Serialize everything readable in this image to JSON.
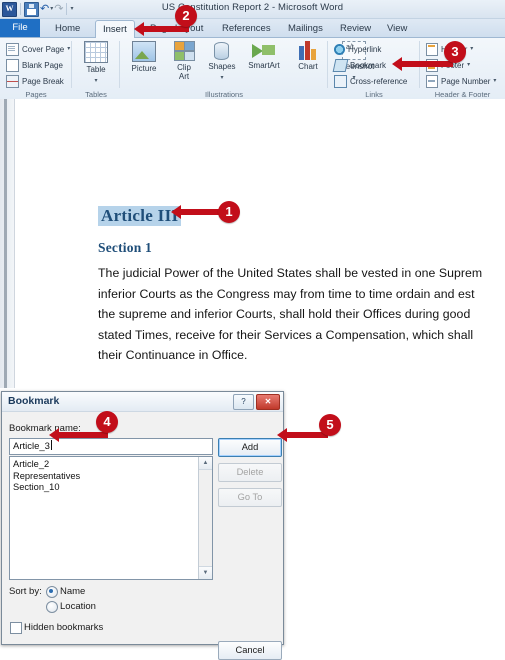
{
  "window": {
    "document_title": "US Constitution Report 2  -  Microsoft Word",
    "quick_access": [
      {
        "name": "word-logo",
        "glyph": "W"
      },
      {
        "name": "save-icon",
        "glyph": ""
      },
      {
        "name": "undo-icon",
        "glyph": "↶"
      },
      {
        "name": "redo-icon",
        "glyph": "↷"
      },
      {
        "name": "customize-qat-icon",
        "glyph": "▾"
      }
    ]
  },
  "tabs": [
    {
      "label": "File",
      "active": false
    },
    {
      "label": "Home",
      "active": false
    },
    {
      "label": "Insert",
      "active": true
    },
    {
      "label": "Page Layout",
      "active": false
    },
    {
      "label": "References",
      "active": false
    },
    {
      "label": "Mailings",
      "active": false
    },
    {
      "label": "Review",
      "active": false
    },
    {
      "label": "View",
      "active": false
    }
  ],
  "ribbon": {
    "groups": [
      {
        "name": "Pages",
        "items": [
          {
            "label": "Cover Page",
            "dropdown": true
          },
          {
            "label": "Blank Page",
            "dropdown": false
          },
          {
            "label": "Page Break",
            "dropdown": false
          }
        ]
      },
      {
        "name": "Tables",
        "items": [
          {
            "label": "Table",
            "dropdown": true
          }
        ]
      },
      {
        "name": "Illustrations",
        "items": [
          {
            "label": "Picture",
            "dropdown": false
          },
          {
            "label": "Clip\nArt",
            "dropdown": false
          },
          {
            "label": "Shapes",
            "dropdown": true
          },
          {
            "label": "SmartArt",
            "dropdown": false
          },
          {
            "label": "Chart",
            "dropdown": false
          },
          {
            "label": "Screenshot",
            "dropdown": true
          }
        ]
      },
      {
        "name": "Links",
        "items": [
          {
            "label": "Hyperlink",
            "dropdown": false
          },
          {
            "label": "Bookmark",
            "dropdown": false
          },
          {
            "label": "Cross-reference",
            "dropdown": false
          }
        ]
      },
      {
        "name": "Header & Footer",
        "items": [
          {
            "label": "Header",
            "dropdown": true
          },
          {
            "label": "Footer",
            "dropdown": true
          },
          {
            "label": "Page Number",
            "dropdown": true
          }
        ]
      }
    ]
  },
  "document": {
    "heading1": "Article III",
    "heading2": "Section 1",
    "body_lines": [
      "The judicial Power of the United States shall be vested in one Suprem",
      "inferior Courts as the Congress may from time to time ordain and est",
      "the supreme and inferior Courts, shall hold their Offices during good",
      "stated Times, receive for their Services a Compensation, which shall",
      "their Continuance in Office."
    ]
  },
  "dialog": {
    "title": "Bookmark",
    "help_glyph": "?",
    "close_glyph": "✕",
    "name_label": "Bookmark name:",
    "name_value": "Article_3",
    "bookmarks": [
      "Article_2",
      "Representatives",
      "Section_10"
    ],
    "buttons": {
      "add": "Add",
      "delete": "Delete",
      "goto": "Go To",
      "cancel": "Cancel"
    },
    "sort_label": "Sort by:",
    "sort_options": [
      {
        "label": "Name",
        "selected": true
      },
      {
        "label": "Location",
        "selected": false
      }
    ],
    "hidden_bookmarks_label": "Hidden bookmarks",
    "hidden_bookmarks_checked": false,
    "scroll_up_glyph": "▲",
    "scroll_down_glyph": "▼"
  },
  "callouts": [
    {
      "number": "1",
      "target": "article-iii-heading"
    },
    {
      "number": "2",
      "target": "insert-tab"
    },
    {
      "number": "3",
      "target": "bookmark-ribbon-button"
    },
    {
      "number": "4",
      "target": "bookmark-name-input"
    },
    {
      "number": "5",
      "target": "add-button"
    }
  ],
  "colors": {
    "accent_red": "#c20e1a",
    "word_blue": "#2b579a",
    "heading_blue": "#1f4e79",
    "selection_blue": "#b6d3ea"
  }
}
